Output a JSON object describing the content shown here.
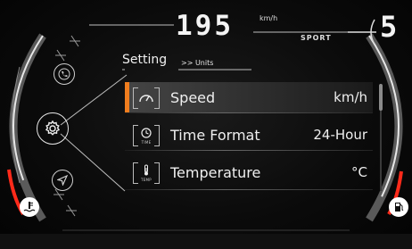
{
  "header": {
    "speed_value": "195",
    "speed_unit": "km/h",
    "drive_mode": "SPORT",
    "gear": "5"
  },
  "menu": {
    "title": "Setting",
    "breadcrumb": ">> Units"
  },
  "settings": [
    {
      "label": "Speed",
      "value": "km/h",
      "icon": "speedometer-icon",
      "selected": true
    },
    {
      "label": "Time Format",
      "value": "24-Hour",
      "icon": "clock-icon",
      "badge": "TIME"
    },
    {
      "label": "Temperature",
      "value": "°C",
      "icon": "thermometer-icon",
      "badge": "TEMP"
    }
  ],
  "colors": {
    "accent": "#f07d1e",
    "fuel_low": "#ff2a1a",
    "temp_high": "#ff2a1a"
  },
  "scroll_position": 0
}
